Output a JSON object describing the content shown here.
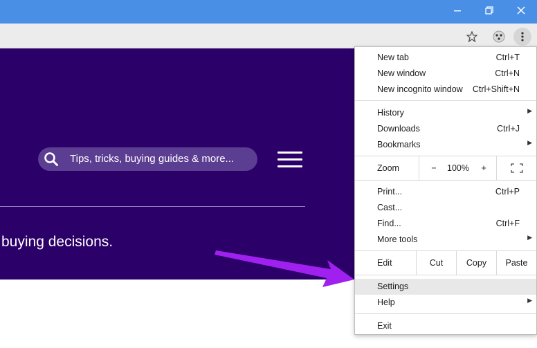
{
  "window": {
    "minimize_label": "—",
    "restore_label": "❐",
    "close_label": "✕"
  },
  "toolbar": {
    "icons": [
      "star-icon",
      "extension-icon",
      "kebab-menu-icon"
    ]
  },
  "page": {
    "search_placeholder": "Tips, tricks, buying guides & more...",
    "hero_text": "buying decisions.",
    "colors": {
      "hero_bg": "#2b0068",
      "search_bg": "#5b3d92",
      "titlebar": "#4a8fe6",
      "arrow": "#a020f0"
    }
  },
  "menu": {
    "new_tab": {
      "label": "New tab",
      "shortcut": "Ctrl+T"
    },
    "new_window": {
      "label": "New window",
      "shortcut": "Ctrl+N"
    },
    "new_incognito": {
      "label": "New incognito window",
      "shortcut": "Ctrl+Shift+N"
    },
    "history": {
      "label": "History",
      "arrow": "▶"
    },
    "downloads": {
      "label": "Downloads",
      "shortcut": "Ctrl+J"
    },
    "bookmarks": {
      "label": "Bookmarks",
      "arrow": "▶"
    },
    "zoom": {
      "label": "Zoom",
      "minus": "−",
      "value": "100%",
      "plus": "+"
    },
    "print": {
      "label": "Print...",
      "shortcut": "Ctrl+P"
    },
    "cast": {
      "label": "Cast..."
    },
    "find": {
      "label": "Find...",
      "shortcut": "Ctrl+F"
    },
    "more_tools": {
      "label": "More tools",
      "arrow": "▶"
    },
    "edit": {
      "label": "Edit",
      "cut": "Cut",
      "copy": "Copy",
      "paste": "Paste"
    },
    "settings": {
      "label": "Settings"
    },
    "help": {
      "label": "Help",
      "arrow": "▶"
    },
    "exit": {
      "label": "Exit"
    }
  }
}
